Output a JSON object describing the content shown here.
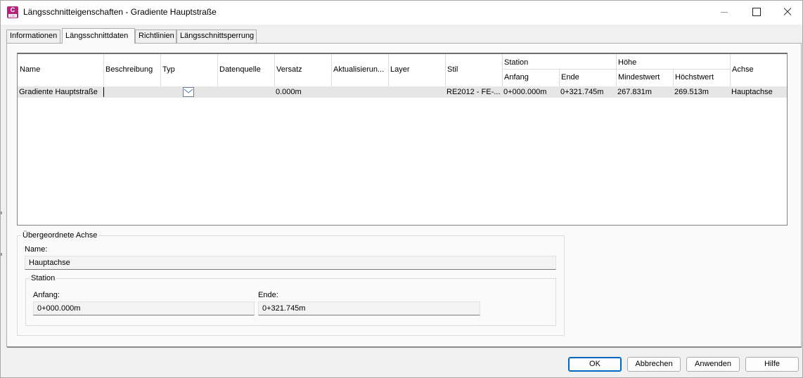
{
  "window": {
    "title": "Längsschnitteigenschaften - Gradiente Hauptstraße",
    "app_icon_letter": "C",
    "app_icon_sub": "C3D"
  },
  "tabs": [
    {
      "label": "Informationen",
      "active": false
    },
    {
      "label": "Längsschnittdaten",
      "active": true
    },
    {
      "label": "Richtlinien",
      "active": false
    },
    {
      "label": "Längsschnittsperrung",
      "active": false
    }
  ],
  "grid": {
    "headers": {
      "name": "Name",
      "beschreibung": "Beschreibung",
      "typ": "Typ",
      "datenquelle": "Datenquelle",
      "versatz": "Versatz",
      "aktualisierung": "Aktualisierun...",
      "layer": "Layer",
      "stil": "Stil",
      "station_group": "Station",
      "station_anfang": "Anfang",
      "station_ende": "Ende",
      "hoehe_group": "Höhe",
      "hoehe_min": "Mindestwert",
      "hoehe_max": "Höchstwert",
      "achse": "Achse"
    },
    "rows": [
      {
        "name": "Gradiente Hauptstraße",
        "beschreibung": "",
        "typ_icon": "profile-type-icon",
        "datenquelle": "",
        "versatz": "0.000m",
        "aktualisierung": "",
        "layer": "",
        "stil": "RE2012 - FE-...",
        "anfang": "0+000.000m",
        "ende": "0+321.745m",
        "mindestwert": "267.831m",
        "hoechstwert": "269.513m",
        "achse": "Hauptachse"
      }
    ]
  },
  "parent_alignment": {
    "group_label": "Übergeordnete Achse",
    "name_label": "Name:",
    "name_value": "Hauptachse",
    "station": {
      "group_label": "Station",
      "start_label": "Anfang:",
      "start_value": "0+000.000m",
      "end_label": "Ende:",
      "end_value": "0+321.745m"
    }
  },
  "buttons": {
    "ok": "OK",
    "cancel": "Abbrechen",
    "apply": "Anwenden",
    "help": "Hilfe"
  },
  "colors": {
    "accent": "#0067c0",
    "app_icon": "#b3247c",
    "selected_row": "#e6e6e6"
  }
}
